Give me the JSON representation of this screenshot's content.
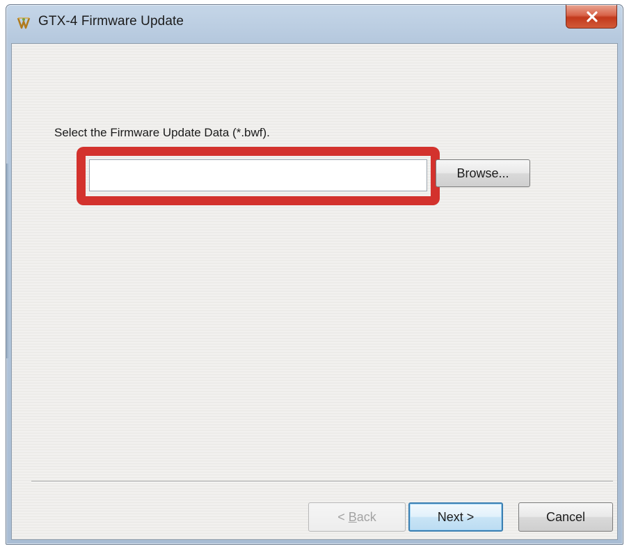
{
  "window": {
    "title": "GTX-4 Firmware Update",
    "icon": "app-logo-icon",
    "close_icon": "close-icon",
    "close_color": "#c8442a"
  },
  "main": {
    "prompt": "Select the Firmware Update Data (*.bwf).",
    "file_input": {
      "value": "",
      "placeholder": ""
    },
    "browse_label": "Browse...",
    "highlight_color": "#d3322d"
  },
  "footer": {
    "back_prefix": "< ",
    "back_mnemonic": "B",
    "back_rest": "ack",
    "next_label": "Next >",
    "cancel_label": "Cancel"
  }
}
